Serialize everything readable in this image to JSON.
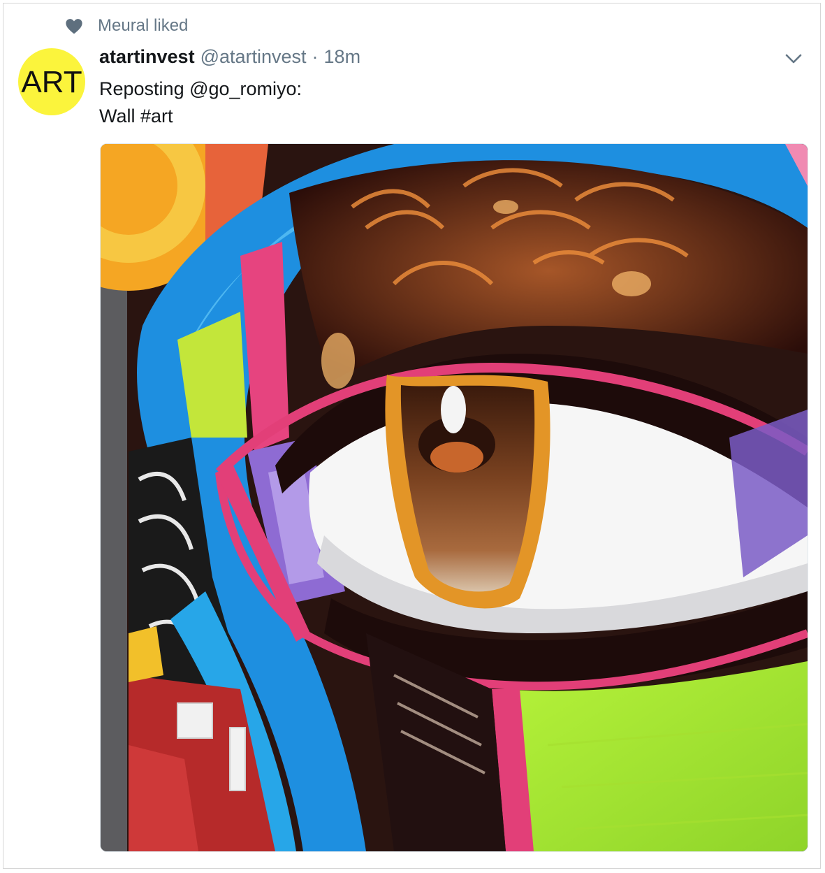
{
  "context": {
    "icon": "heart-icon",
    "label": "Meural liked"
  },
  "tweet": {
    "avatar": {
      "text": "ART",
      "background": "#fbf43c"
    },
    "display_name": "atartinvest",
    "handle": "@atartinvest",
    "separator": "·",
    "timestamp": "18m",
    "text_lines": [
      "Reposting @go_romiyo:",
      "Wall #art"
    ],
    "menu_icon": "chevron-down-icon",
    "media": {
      "kind": "photo",
      "subject": "colorful eye mural"
    }
  },
  "colors": {
    "secondary_text": "#657786",
    "primary_text": "#14171a",
    "border": "#d6d6d6"
  }
}
